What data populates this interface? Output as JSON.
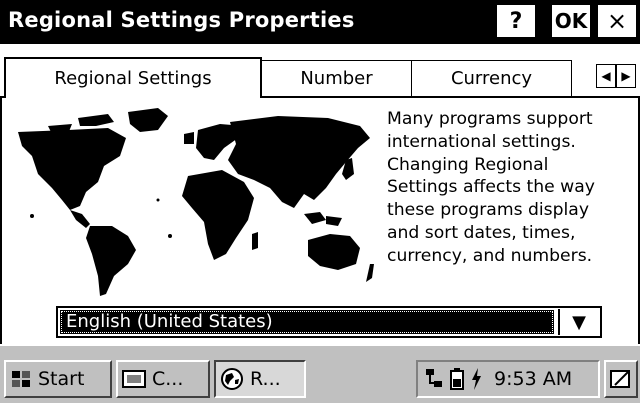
{
  "window": {
    "title": "Regional Settings Properties",
    "help_label": "?",
    "ok_label": "OK",
    "close_label": "×"
  },
  "tabs": [
    {
      "label": "Regional Settings",
      "active": true
    },
    {
      "label": "Number",
      "active": false
    },
    {
      "label": "Currency",
      "active": false
    }
  ],
  "tab_scroll": {
    "left_icon": "arrow-left-icon",
    "right_icon": "arrow-right-icon"
  },
  "panel": {
    "map_icon": "world-map-icon",
    "description_lines": [
      "Many programs support",
      "international settings.",
      "Changing Regional",
      "Settings affects the way",
      "these programs display",
      "and sort dates, times,",
      "currency, and numbers."
    ]
  },
  "locale_select": {
    "value": "English (United States)",
    "arrow_icon": "chevron-down-icon"
  },
  "taskbar": {
    "start_label": "Start",
    "items": [
      {
        "label": "C...",
        "icon": "control-panel-icon"
      },
      {
        "label": "R...",
        "icon": "globe-icon"
      }
    ],
    "time": "9:53 AM",
    "tray_icons": [
      "network-icon",
      "battery-icon",
      "power-icon"
    ],
    "desktop_icon": "show-desktop-icon"
  },
  "colors": {
    "titlebar": "#000000",
    "panel": "#ffffff",
    "taskbar": "#c0c0c0",
    "selection": "#000000"
  }
}
